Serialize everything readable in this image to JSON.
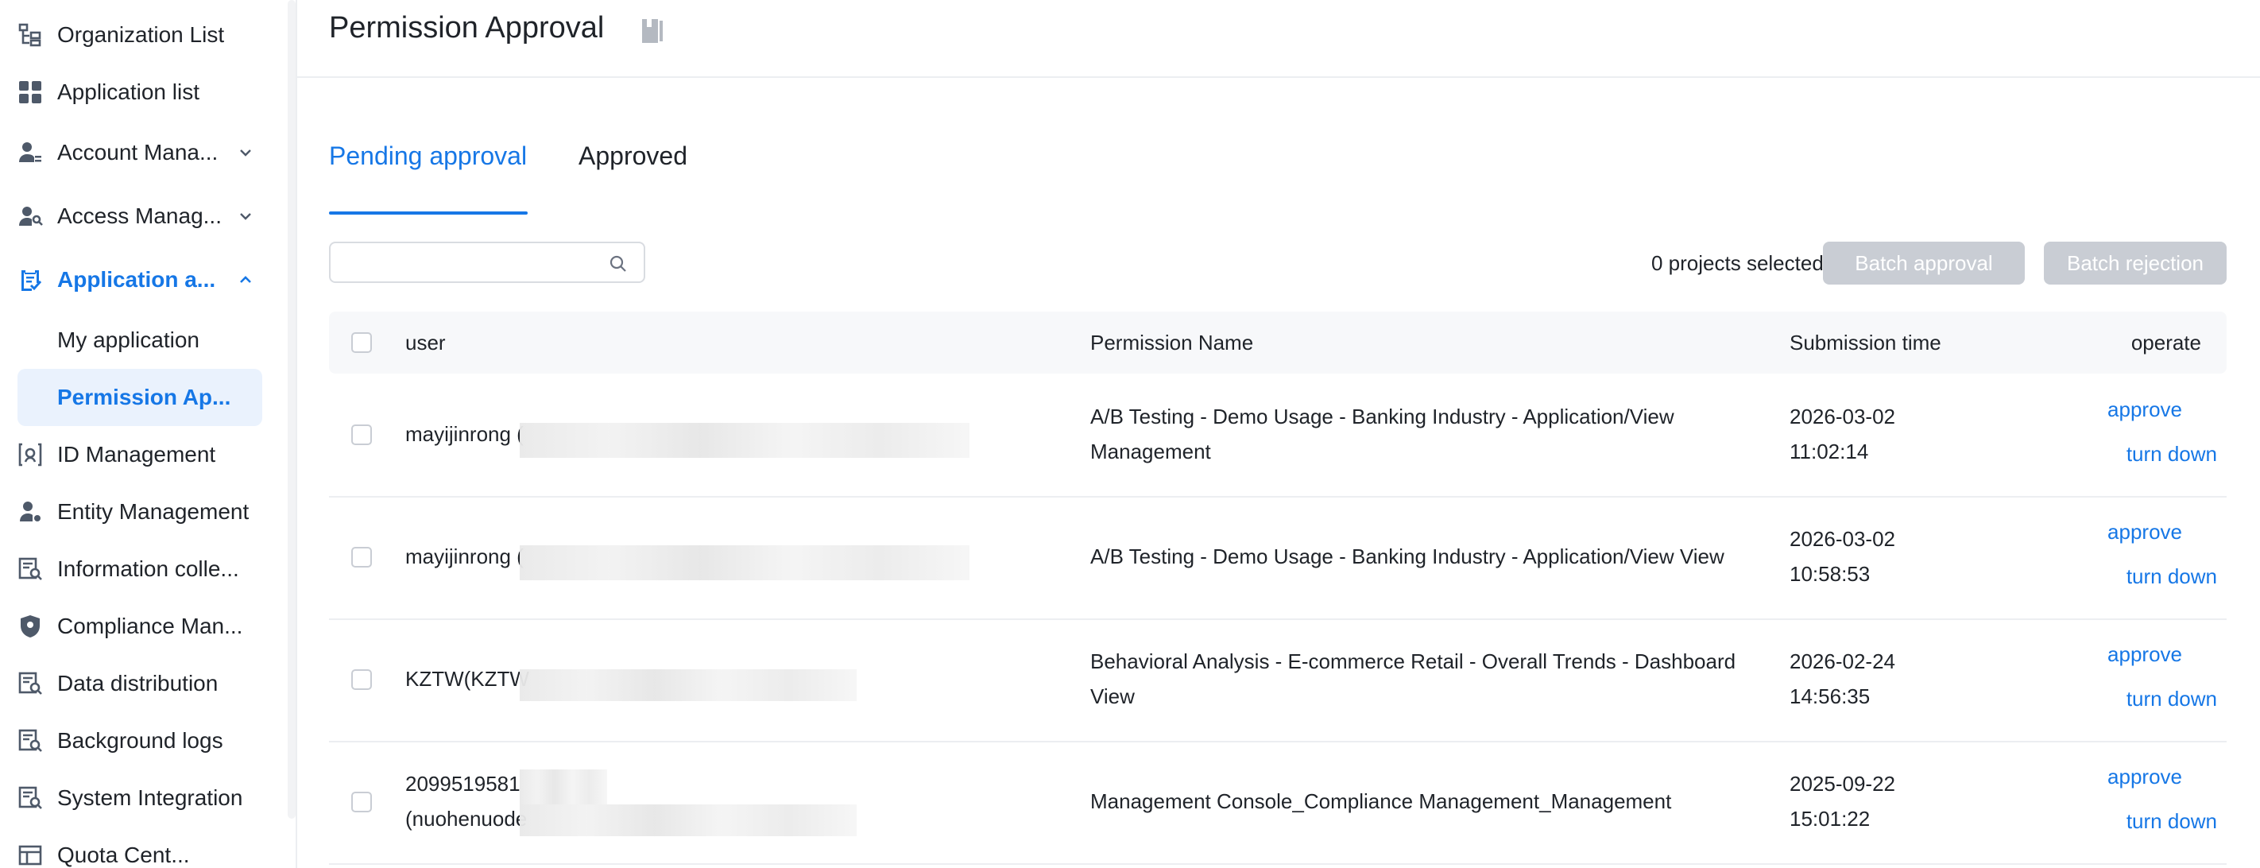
{
  "sidebar": {
    "items": [
      {
        "label": "Organization List",
        "icon": "org-tree-icon"
      },
      {
        "label": "Application list",
        "icon": "grid-icon"
      },
      {
        "label": "Account Mana...",
        "icon": "user-list-icon",
        "expandable": true
      },
      {
        "label": "Access Manag...",
        "icon": "key-user-icon",
        "expandable": true
      },
      {
        "label": "Application a...",
        "icon": "clipboard-check-icon",
        "expandable": true,
        "expanded": true,
        "active": true
      },
      {
        "label": "ID Management",
        "icon": "id-icon"
      },
      {
        "label": "Entity Management",
        "icon": "entity-user-icon"
      },
      {
        "label": "Information colle...",
        "icon": "info-search-icon"
      },
      {
        "label": "Compliance Man...",
        "icon": "shield-icon"
      },
      {
        "label": "Data distribution",
        "icon": "data-search-icon"
      },
      {
        "label": "Background logs",
        "icon": "log-search-icon"
      },
      {
        "label": "System Integration",
        "icon": "integration-icon"
      },
      {
        "label": "Quota Cent...",
        "icon": "quota-icon"
      }
    ],
    "sub_items": [
      {
        "label": "My application"
      },
      {
        "label": "Permission Ap...",
        "selected": true
      }
    ]
  },
  "header": {
    "title": "Permission Approval",
    "icon": "document-icon"
  },
  "tabs": [
    {
      "label": "Pending approval",
      "active": true
    },
    {
      "label": "Approved"
    }
  ],
  "search": {
    "placeholder": "",
    "value": ""
  },
  "toolbar": {
    "selected_text": "0 projects selected",
    "batch_approval": "Batch approval",
    "batch_rejection": "Batch rejection"
  },
  "table": {
    "columns": {
      "user": "user",
      "permission": "Permission Name",
      "time": "Submission time",
      "operate": "operate"
    },
    "rows": [
      {
        "user": "mayijinrong (",
        "permission": "A/B Testing - Demo Usage - Banking Industry - Application/View Management",
        "date": "2026-03-02",
        "time": "11:02:14",
        "approve": "approve",
        "reject": "turn down"
      },
      {
        "user": "mayijinrong (",
        "permission": "A/B Testing - Demo Usage - Banking Industry - Application/View View",
        "date": "2026-03-02",
        "time": "10:58:53",
        "approve": "approve",
        "reject": "turn down"
      },
      {
        "user": "KZTW(KZTW",
        "permission": "Behavioral Analysis - E-commerce Retail - Overall Trends - Dashboard View",
        "date": "2026-02-24",
        "time": "14:56:35",
        "approve": "approve",
        "reject": "turn down"
      },
      {
        "user": "2099519581",
        "user_line2": "(nuohenuode",
        "permission": "Management Console_Compliance Management_Management",
        "date": "2025-09-22",
        "time": "15:01:22",
        "approve": "approve",
        "reject": "turn down"
      }
    ]
  },
  "colors": {
    "accent": "#1677e6",
    "disabled_button": "#c9cdd4",
    "sub_item_selected_bg": "#eaf2fd"
  }
}
